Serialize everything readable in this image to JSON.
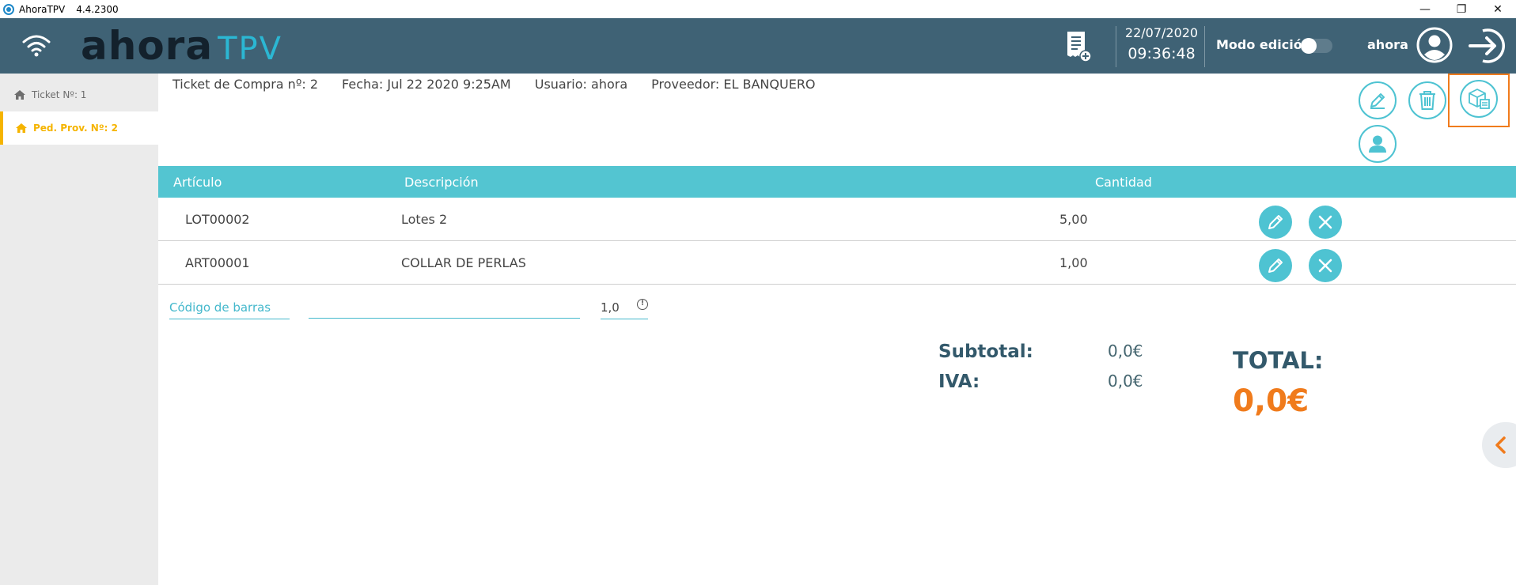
{
  "window": {
    "app_name": "AhoraTPV",
    "version": "4.4.2300",
    "minimize": "—",
    "restore": "❐",
    "close": "✕"
  },
  "header": {
    "logo_main": "ahora",
    "logo_sub": "TPV",
    "date": "22/07/2020",
    "time": "09:36:48",
    "mode_label": "Modo edición",
    "user": "ahora"
  },
  "sidebar": {
    "items": [
      {
        "label": "Ticket Nº: 1"
      },
      {
        "label": "Ped. Prov. Nº: 2"
      }
    ]
  },
  "info": {
    "ticket": "Ticket de Compra nº: 2",
    "fecha": "Fecha: Jul 22 2020 9:25AM",
    "usuario": "Usuario: ahora",
    "proveedor": "Proveedor: EL BANQUERO"
  },
  "table": {
    "headers": {
      "articulo": "Artículo",
      "descripcion": "Descripción",
      "cantidad": "Cantidad"
    },
    "rows": [
      {
        "articulo": "LOT00002",
        "descripcion": "Lotes 2",
        "cantidad": "5,00"
      },
      {
        "articulo": "ART00001",
        "descripcion": "COLLAR DE PERLAS",
        "cantidad": "1,00"
      }
    ]
  },
  "barcode": {
    "label": "Código de barras",
    "quantity": "1,0"
  },
  "totals": {
    "subtotal_label": "Subtotal:",
    "subtotal_value": "0,0€",
    "iva_label": "IVA:",
    "iva_value": "0,0€",
    "total_label": "TOTAL:",
    "total_value": "0,0€"
  },
  "colors": {
    "header_bg": "#3f6275",
    "accent": "#4ec3d2",
    "table_header": "#53c5d1",
    "highlight": "#f07b1c",
    "active_tab": "#f5b400"
  }
}
